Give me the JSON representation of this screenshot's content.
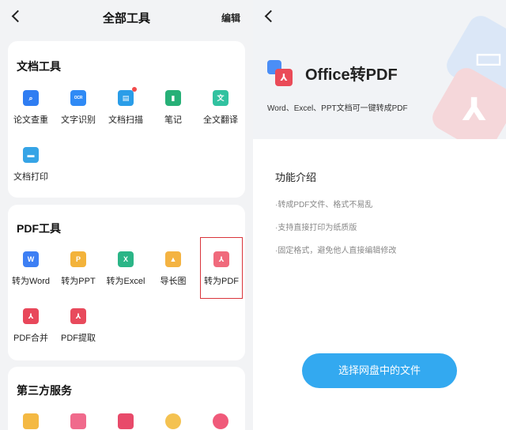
{
  "header": {
    "title": "全部工具",
    "edit_label": "编辑"
  },
  "sections": [
    {
      "title": "文档工具",
      "items": [
        {
          "label": "论文查重",
          "icon": "document-check-icon",
          "color": "#2f7df2"
        },
        {
          "label": "文字识别",
          "icon": "ocr-icon",
          "color": "#2f8af5",
          "mark": "OCR"
        },
        {
          "label": "文档扫描",
          "icon": "scan-icon",
          "color": "#2a9de8",
          "badge": true
        },
        {
          "label": "笔记",
          "icon": "notebook-icon",
          "color": "#27b077"
        },
        {
          "label": "全文翻译",
          "icon": "translate-icon",
          "color": "#31c2a0",
          "mark": "文"
        },
        {
          "label": "文档打印",
          "icon": "printer-icon",
          "color": "#36a4e6"
        }
      ]
    },
    {
      "title": "PDF工具",
      "items": [
        {
          "label": "转为Word",
          "icon": "word-icon",
          "color": "#3d7ff4",
          "mark": "W"
        },
        {
          "label": "转为PPT",
          "icon": "ppt-icon",
          "color": "#f3b33b",
          "mark": "P"
        },
        {
          "label": "转为Excel",
          "icon": "excel-icon",
          "color": "#2bb587",
          "mark": "X"
        },
        {
          "label": "导长图",
          "icon": "image-icon",
          "color": "#f4b342"
        },
        {
          "label": "转为PDF",
          "icon": "pdf-convert-icon",
          "color": "#f06a7c"
        },
        {
          "label": "PDF合并",
          "icon": "pdf-merge-icon",
          "color": "#e8475a"
        },
        {
          "label": "PDF提取",
          "icon": "pdf-extract-icon",
          "color": "#e84a5c"
        }
      ]
    },
    {
      "title": "第三方服务",
      "items": [
        {
          "icon": "service-icon-1",
          "color": "#f4b943"
        },
        {
          "icon": "service-icon-2",
          "color": "#f06a8c"
        },
        {
          "icon": "service-icon-3",
          "color": "#e84a6a"
        },
        {
          "icon": "service-icon-4",
          "color": "#f4c251"
        },
        {
          "icon": "service-icon-5",
          "color": "#f05a7a"
        }
      ]
    }
  ],
  "detail": {
    "title": "Office转PDF",
    "subtitle": "Word、Excel、PPT文档可一键转成PDF",
    "features_title": "功能介绍",
    "features": [
      "·转成PDF文件、格式不易乱",
      "·支持直接打印为纸质版",
      "·固定格式，避免他人直接编辑修改"
    ],
    "action_label": "选择网盘中的文件",
    "accent": "#33a9f0"
  }
}
